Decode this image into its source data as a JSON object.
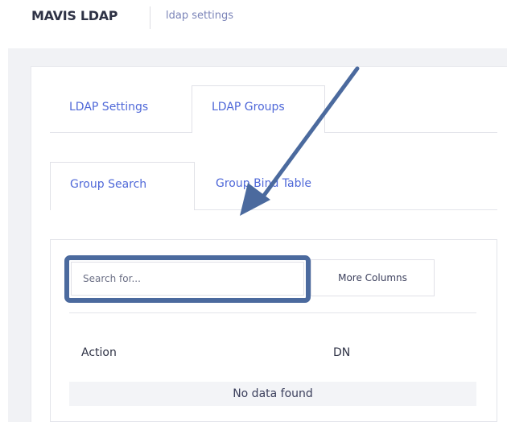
{
  "header": {
    "app_title": "MAVIS LDAP",
    "breadcrumb": "ldap settings"
  },
  "tabs_primary": {
    "items": [
      {
        "label": "LDAP Settings",
        "active": false
      },
      {
        "label": "LDAP Groups",
        "active": true
      }
    ]
  },
  "tabs_secondary": {
    "items": [
      {
        "label": "Group Search",
        "active": true
      },
      {
        "label": "Group Bind Table",
        "active": false
      }
    ]
  },
  "toolbar": {
    "search_placeholder": "Search for...",
    "more_columns_label": "More Columns"
  },
  "table": {
    "columns": [
      "Action",
      "DN"
    ],
    "empty_message": "No data found"
  },
  "annotation": {
    "color": "#4b6a9e"
  },
  "colors": {
    "accent": "#4f68d8",
    "page_background": "#f1f2f5"
  }
}
